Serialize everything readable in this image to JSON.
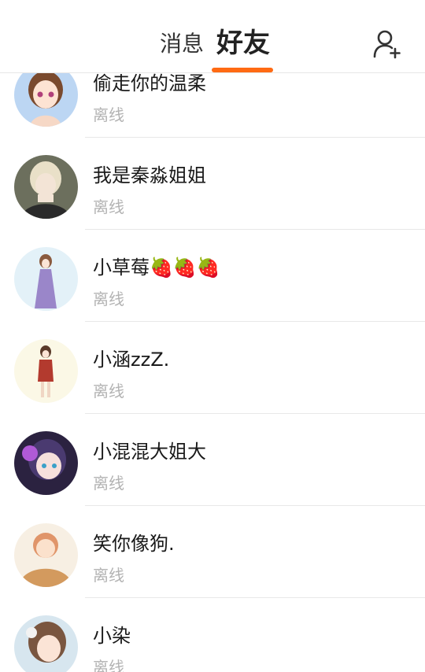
{
  "header": {
    "tabs": [
      {
        "label": "消息",
        "active": false
      },
      {
        "label": "好友",
        "active": true
      }
    ],
    "accent_color": "#ff6a13",
    "add_friend_icon": "add-user-icon"
  },
  "friends": [
    {
      "name": "偷走你的温柔",
      "status": "离线",
      "avatar_bg": "#bcd6f3",
      "avatar_fg": "#7a4a2e"
    },
    {
      "name": "我是秦淼姐姐",
      "status": "离线",
      "avatar_bg": "#6c6f5d",
      "avatar_fg": "#e9e0c8"
    },
    {
      "name": "小草莓🍓🍓🍓",
      "status": "离线",
      "avatar_bg": "#e3f1f8",
      "avatar_fg": "#9a86c9"
    },
    {
      "name": "小涵zzZ.",
      "status": "离线",
      "avatar_bg": "#fbf8e6",
      "avatar_fg": "#b33a2e"
    },
    {
      "name": "小混混大姐大",
      "status": "离线",
      "avatar_bg": "#2b2240",
      "avatar_fg": "#b05ad6"
    },
    {
      "name": "笑你像狗.",
      "status": "离线",
      "avatar_bg": "#f7efe3",
      "avatar_fg": "#d39a5e"
    },
    {
      "name": "小染",
      "status": "离线",
      "avatar_bg": "#d7e6ef",
      "avatar_fg": "#7a5640"
    }
  ]
}
